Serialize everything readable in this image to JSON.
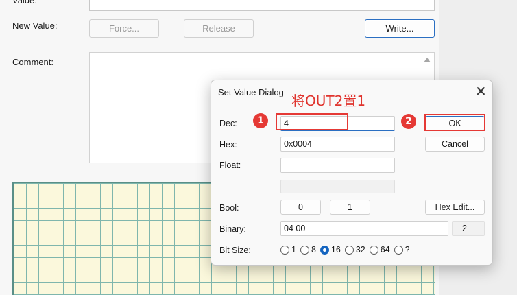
{
  "background": {
    "value_label": "Value:",
    "new_value_label": "New Value:",
    "force_button": "Force...",
    "release_button": "Release",
    "write_button": "Write...",
    "comment_label": "Comment:"
  },
  "dialog": {
    "title": "Set Value Dialog",
    "annotation": "将OUT2置1",
    "dec_label": "Dec:",
    "dec_value": "4",
    "hex_label": "Hex:",
    "hex_value": "0x0004",
    "float_label": "Float:",
    "float_value": "",
    "bool_label": "Bool:",
    "bool_false": "0",
    "bool_true": "1",
    "hex_edit_button": "Hex Edit...",
    "binary_label": "Binary:",
    "binary_value": "04 00",
    "binary_count": "2",
    "bit_size_label": "Bit Size:",
    "bit_sizes": [
      "1",
      "8",
      "16",
      "32",
      "64",
      "?"
    ],
    "selected_bit_size": "16",
    "ok_button": "OK",
    "cancel_button": "Cancel",
    "step1": "1",
    "step2": "2"
  },
  "colors": {
    "annotation_red": "#e53935",
    "accent_blue": "#2b6fc2",
    "grid_fill": "#fbf8dc",
    "grid_line": "#7fb6ad"
  }
}
